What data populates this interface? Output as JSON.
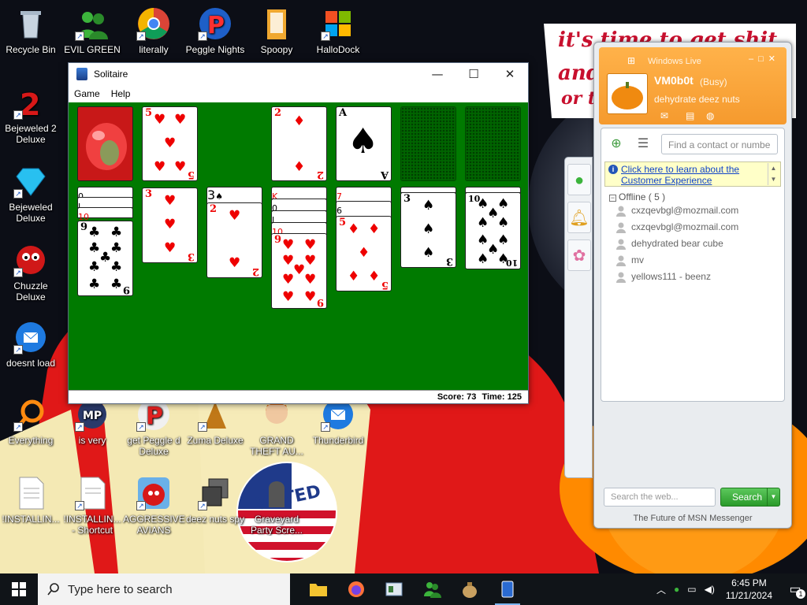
{
  "wallpaper": {
    "line1": "it's time to get shit",
    "line2": "and",
    "line3": "or t"
  },
  "desktop_icons": [
    {
      "id": "recycle",
      "label": "Recycle Bin"
    },
    {
      "id": "evilgreen",
      "label": "EVIL GREEN MEN CO..."
    },
    {
      "id": "chrome",
      "label": "literally"
    },
    {
      "id": "peggle",
      "label": "Peggle Nights Del..."
    },
    {
      "id": "spoopy",
      "label": "Spoopy"
    },
    {
      "id": "hallodock",
      "label": "HalloDock"
    },
    {
      "id": "bejeweled2",
      "label": "Bejeweled 2 Deluxe"
    },
    {
      "id": "bejeweled",
      "label": "Bejeweled Deluxe"
    },
    {
      "id": "chuzzle",
      "label": "Chuzzle Deluxe"
    },
    {
      "id": "doesnt",
      "label": "doesnt load"
    },
    {
      "id": "everything",
      "label": "Everything"
    },
    {
      "id": "isvery",
      "label": "is very"
    },
    {
      "id": "getpeggle",
      "label": "get Peggle d Deluxe"
    },
    {
      "id": "zuma",
      "label": "Zuma Deluxe"
    },
    {
      "id": "gta",
      "label": "GRAND THEFT AU..."
    },
    {
      "id": "thunderbird",
      "label": "Thunderbird"
    },
    {
      "id": "installing1",
      "label": "!INSTALLIN..."
    },
    {
      "id": "installing2",
      "label": "!INSTALLIN... - Shortcut"
    },
    {
      "id": "angry",
      "label": "AGGRESSIVE AVIANS"
    },
    {
      "id": "deeznuts",
      "label": "deez nuts spy"
    },
    {
      "id": "graveyard",
      "label": "Graveyard Party Scre..."
    }
  ],
  "voted_sticker": "VOTED",
  "solitaire": {
    "title": "Solitaire",
    "menu": [
      "Game",
      "Help"
    ],
    "score_label": "Score:",
    "score": "73",
    "time_label": "Time:",
    "time": "125",
    "foundations": [
      {
        "rank": "2",
        "suit": "♦",
        "color": "red"
      },
      {
        "rank": "A",
        "suit": "♠",
        "color": "black"
      }
    ],
    "waste_top": {
      "rank": "5",
      "suit": "♥",
      "color": "red"
    },
    "tableau": [
      {
        "top": {
          "rank": "9",
          "suit": "♣",
          "color": "black"
        }
      },
      {
        "top": {
          "rank": "3",
          "suit": "♥",
          "color": "red"
        }
      },
      {
        "top": {
          "rank": "2",
          "suit": "♥",
          "color": "red"
        }
      },
      {
        "top": {
          "rank": "9",
          "suit": "♥",
          "color": "red"
        }
      },
      {
        "top": {
          "rank": "5",
          "suit": "♦",
          "color": "red"
        }
      },
      {
        "top": {
          "rank": "3",
          "suit": "♠",
          "color": "black"
        }
      },
      {
        "top": {
          "rank": "10",
          "suit": "♠",
          "color": "black"
        }
      }
    ],
    "buried_labels": [
      "0",
      "J",
      "10",
      "3",
      "2",
      "K",
      "0",
      "J",
      "7",
      "6"
    ]
  },
  "msn": {
    "brand": "Windows Live",
    "display_name": "VM0b0t",
    "status": "(Busy)",
    "personal_message": "dehydrate deez nuts",
    "find_placeholder": "Find a contact or numbe",
    "ad_text": "Click here to learn about the Customer Experience",
    "group_label": "Offline ( 5 )",
    "contacts": [
      "cxzqevbgl@mozmail.com",
      "cxzqevbgl@mozmail.com",
      "dehydrated bear cube",
      "mv",
      "yellows111 - beenz"
    ],
    "search_placeholder": "Search the web...",
    "search_button": "Search",
    "footer": "The Future of MSN Messenger"
  },
  "taskbar": {
    "search_placeholder": "Type here to search",
    "time": "6:45 PM",
    "date": "11/21/2024",
    "notification_count": "1"
  }
}
